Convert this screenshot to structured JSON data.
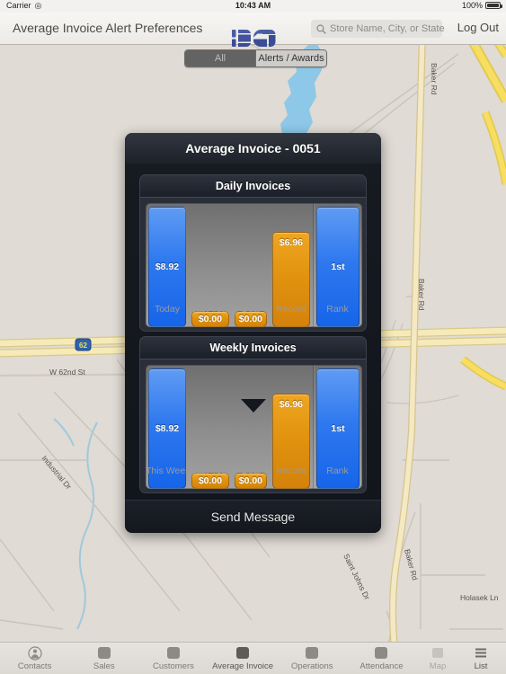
{
  "status_bar": {
    "carrier": "Carrier",
    "wifi_icon": "wifi-icon",
    "time": "10:43 AM",
    "battery_percent": "100%",
    "battery_icon": "battery-full-icon"
  },
  "nav_bar": {
    "title": "Average Invoice Alert Preferences",
    "logo": "ics-logo",
    "search": {
      "icon": "search-icon",
      "placeholder": "Store Name, City, or State",
      "value": ""
    },
    "logout_label": "Log Out"
  },
  "segmented_control": {
    "options": [
      "All",
      "Alerts / Awards"
    ],
    "selected": "All"
  },
  "modal": {
    "title": "Average Invoice - 0051",
    "send_message_label": "Send Message"
  },
  "chart_data": [
    {
      "type": "bar",
      "title": "Daily Invoices",
      "xlabel": "",
      "ylabel": "",
      "grid": false,
      "legend": "none",
      "ylim": [
        0,
        10
      ],
      "categories": [
        "Today",
        "Last Year",
        "Goal",
        "Record",
        "Rank"
      ],
      "values": [
        8.92,
        0.0,
        0.0,
        6.96,
        1
      ],
      "labels": [
        "$8.92",
        "$0.00",
        "$0.00",
        "$6.96",
        "1st"
      ],
      "colors": [
        "#2f79ef",
        "#e2930f",
        "#e2930f",
        "#e2930f",
        "#2f79ef"
      ]
    },
    {
      "type": "bar",
      "title": "Weekly Invoices",
      "xlabel": "",
      "ylabel": "",
      "grid": false,
      "legend": "none",
      "ylim": [
        0,
        10
      ],
      "categories": [
        "This Week",
        "Last Year",
        "Goal",
        "Record",
        "Rank"
      ],
      "values": [
        8.92,
        0.0,
        0.0,
        6.96,
        1
      ],
      "labels": [
        "$8.92",
        "$0.00",
        "$0.00",
        "$6.96",
        "1st"
      ],
      "colors": [
        "#2f79ef",
        "#e2930f",
        "#e2930f",
        "#e2930f",
        "#2f79ef"
      ]
    }
  ],
  "map": {
    "labels": [
      "Baker Rd",
      "W 62nd St",
      "Industrial Dr",
      "Saint Johns Dr",
      "Holasek Ln"
    ],
    "highway_shield": "62"
  },
  "tab_bar": {
    "items": [
      {
        "label": "Contacts",
        "icon": "person-icon",
        "active": false
      },
      {
        "label": "Sales",
        "icon": "sales-icon",
        "active": false
      },
      {
        "label": "Customers",
        "icon": "customers-icon",
        "active": false
      },
      {
        "label": "Average Invoice",
        "icon": "average-invoice-icon",
        "active": true
      },
      {
        "label": "Operations",
        "icon": "operations-icon",
        "active": false
      },
      {
        "label": "Attendance",
        "icon": "attendance-icon",
        "active": false
      }
    ],
    "view_toggle": [
      {
        "label": "Map",
        "icon": "map-icon",
        "active": false
      },
      {
        "label": "List",
        "icon": "list-icon",
        "active": true
      }
    ]
  },
  "colors": {
    "accent_blue": "#2f79ef",
    "accent_orange": "#e2930f",
    "panel_dark": "#171a21",
    "chrome": "#e6e3de",
    "map_land": "#e0dbd4",
    "map_road": "#efe4c4",
    "map_water": "#8ec8e8"
  }
}
